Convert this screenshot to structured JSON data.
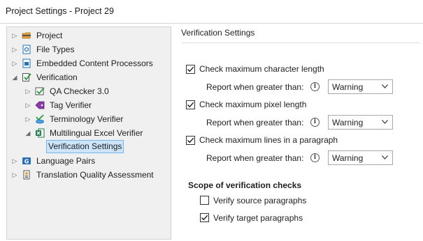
{
  "window": {
    "title": "Project Settings - Project 29"
  },
  "tree": {
    "items": [
      {
        "label": "Project"
      },
      {
        "label": "File Types"
      },
      {
        "label": "Embedded Content Processors"
      },
      {
        "label": "Verification"
      },
      {
        "label": "QA Checker 3.0"
      },
      {
        "label": "Tag Verifier"
      },
      {
        "label": "Terminology Verifier"
      },
      {
        "label": "Multilingual Excel Verifier"
      },
      {
        "label": "Verification Settings"
      },
      {
        "label": "Language Pairs"
      },
      {
        "label": "Translation Quality Assessment"
      }
    ],
    "selected": "Verification Settings"
  },
  "settings": {
    "section_title": "Verification Settings",
    "checks": [
      {
        "label": "Check maximum character length",
        "checked": true,
        "report_label": "Report when greater than:",
        "report_value": "Warning"
      },
      {
        "label": "Check maximum pixel length",
        "checked": true,
        "report_label": "Report when greater than:",
        "report_value": "Warning"
      },
      {
        "label": "Check maximum lines in a paragraph",
        "checked": true,
        "report_label": "Report when greater than:",
        "report_value": "Warning"
      }
    ],
    "scope": {
      "heading": "Scope of verification checks",
      "options": [
        {
          "label": "Verify source paragraphs",
          "checked": false
        },
        {
          "label": "Verify target paragraphs",
          "checked": true
        }
      ]
    }
  },
  "icons": {
    "expand_collapsed": "chevron-right-icon",
    "expand_expanded": "chevron-down-icon",
    "info": "info-icon",
    "dropdown": "chevron-down-icon"
  }
}
